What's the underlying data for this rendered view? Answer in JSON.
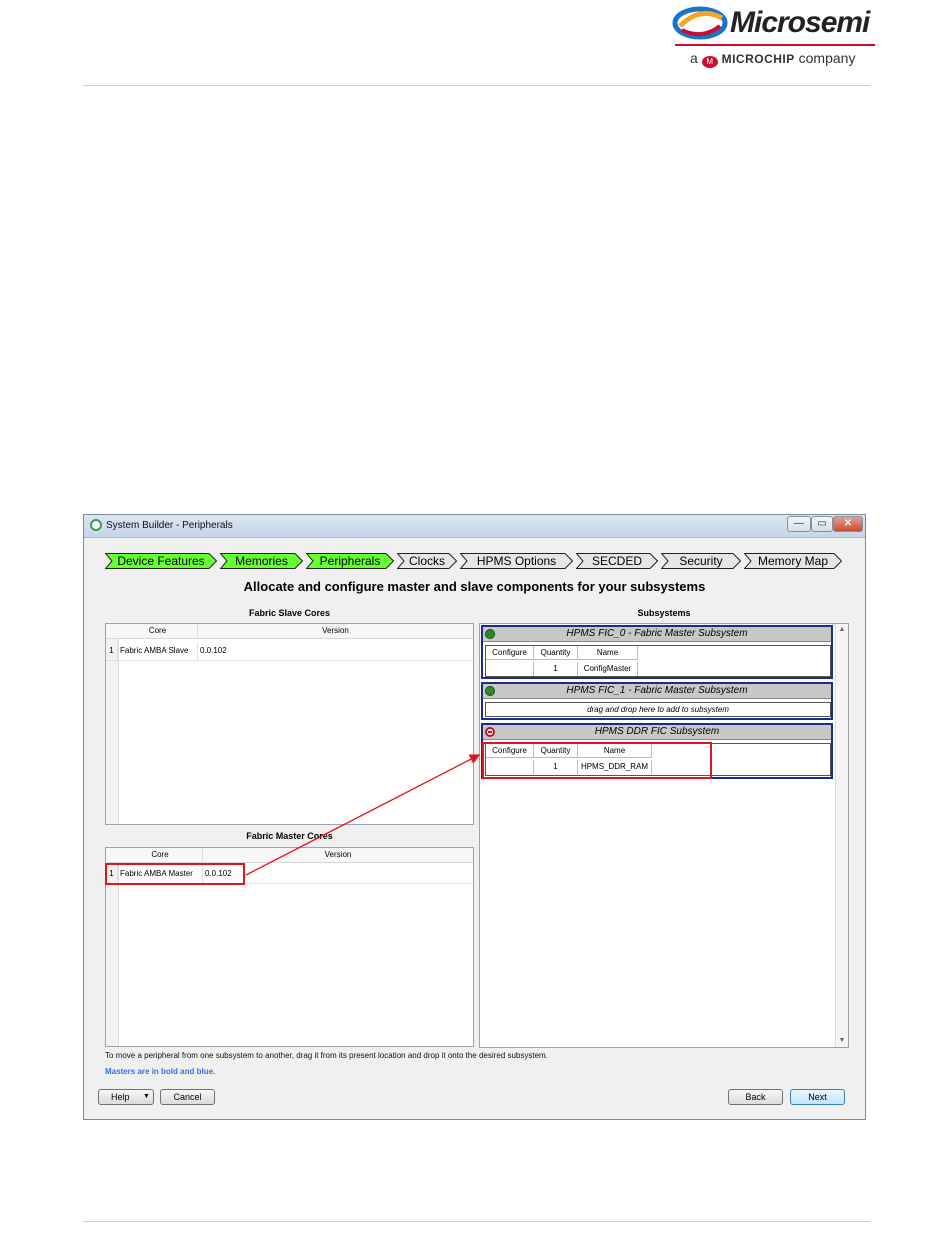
{
  "logo": {
    "brand": "Microsemi",
    "tagline_prefix": "a",
    "tagline_brand": "MICROCHIP",
    "tagline_suffix": "company",
    "colors": {
      "brand_red": "#c8102e",
      "brand_blue": "#1a75c9"
    }
  },
  "window": {
    "title": "System Builder - Peripherals",
    "controls": {
      "minimize": "—",
      "maximize": "▭",
      "close": "✕"
    }
  },
  "steps": [
    {
      "label": "Device Features",
      "state": "done"
    },
    {
      "label": "Memories",
      "state": "done"
    },
    {
      "label": "Peripherals",
      "state": "current"
    },
    {
      "label": "Clocks",
      "state": "pending"
    },
    {
      "label": "HPMS Options",
      "state": "pending"
    },
    {
      "label": "SECDED",
      "state": "pending"
    },
    {
      "label": "Security",
      "state": "pending"
    },
    {
      "label": "Memory Map",
      "state": "pending"
    }
  ],
  "step_colors": {
    "done": "#66ff33",
    "pending": "#e6e6e6",
    "border": "#222222"
  },
  "heading": "Allocate and configure master and slave components for your subsystems",
  "slave_cores": {
    "title": "Fabric Slave Cores",
    "columns": [
      "Core",
      "Version"
    ],
    "rows": [
      {
        "num": "1",
        "core": "Fabric AMBA Slave",
        "version": "0.0.102"
      }
    ]
  },
  "master_cores": {
    "title": "Fabric Master Cores",
    "columns": [
      "Core",
      "Version"
    ],
    "rows": [
      {
        "num": "1",
        "core": "Fabric AMBA Master",
        "version": "0.0.102"
      }
    ]
  },
  "subsystems": {
    "title": "Subsystems",
    "items": [
      {
        "name": "HPMS FIC_0 - Fabric Master Subsystem",
        "status": "green",
        "columns": [
          "Configure",
          "Quantity",
          "Name"
        ],
        "row": {
          "configure": "",
          "quantity": "1",
          "name": "ConfigMaster"
        }
      },
      {
        "name": "HPMS FIC_1 - Fabric Master Subsystem",
        "status": "green",
        "drop_hint": "drag and drop here to add to subsystem"
      },
      {
        "name": "HPMS DDR FIC Subsystem",
        "status": "error",
        "columns": [
          "Configure",
          "Quantity",
          "Name"
        ],
        "row": {
          "configure": "",
          "quantity": "1",
          "name": "HPMS_DDR_RAM"
        }
      }
    ]
  },
  "hint": "To move a peripheral from one subsystem to another, drag it from its present location and drop it onto the desired subsystem.",
  "masters_note": "Masters are in bold and blue.",
  "buttons": {
    "help": "Help",
    "help_arrow": "▼",
    "cancel": "Cancel",
    "back": "Back",
    "next": "Next"
  },
  "scroll": {
    "up": "▲",
    "down": "▼"
  },
  "annotation_color": "#e0161e"
}
